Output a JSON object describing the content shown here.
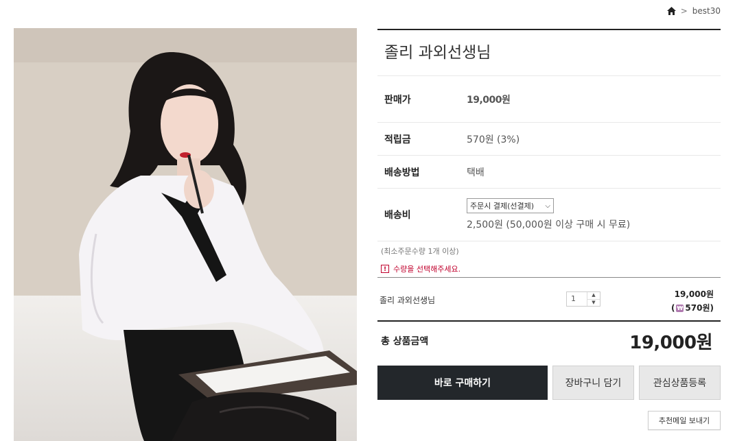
{
  "breadcrumb": {
    "home_icon": "home-icon",
    "separator": ">",
    "current": "best30"
  },
  "product": {
    "name": "졸리 과외선생님",
    "price_label": "판매가",
    "price": "19,000원",
    "points_label": "적립금",
    "points": "570원 (3%)",
    "method_label": "배송방법",
    "method": "택배",
    "shipping_label": "배송비",
    "shipping_option": "주문시 결제(선결제)",
    "shipping_note": "2,500원 (50,000원 이상 구매 시 무료)",
    "min_qty": "(최소주문수량 1개 이상)",
    "qty_warning": "수량을 선택해주세요."
  },
  "option": {
    "name": "졸리 과외선생님",
    "qty": "1",
    "price": "19,000원",
    "points_prefix": "(",
    "points": "570원)"
  },
  "total": {
    "label": "총 상품금액",
    "value": "19,000원"
  },
  "buttons": {
    "buy": "바로 구매하기",
    "cart": "장바구니 담기",
    "wishlist": "관심상품등록",
    "recommend_mail": "추천메일 보내기"
  },
  "colors": {
    "price_accent": "#8a1538",
    "warning": "#c0002c",
    "buy_button": "#23272b"
  }
}
